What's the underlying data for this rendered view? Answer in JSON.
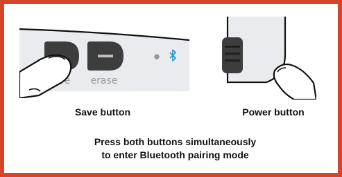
{
  "device_labels": {
    "save": "save",
    "erase": "erase"
  },
  "icons": {
    "indicator": "status-led-icon",
    "bluetooth": "bluetooth-icon"
  },
  "colors": {
    "frame": "#d4452a",
    "device_panel": "#e9ebee",
    "button": "#3d3d3d",
    "bluetooth": "#1f9bd8"
  },
  "captions": {
    "save_button": "Save button",
    "power_button": "Power button"
  },
  "instruction": {
    "line1": "Press both buttons simultaneously",
    "line2": "to enter Bluetooth pairing mode"
  }
}
